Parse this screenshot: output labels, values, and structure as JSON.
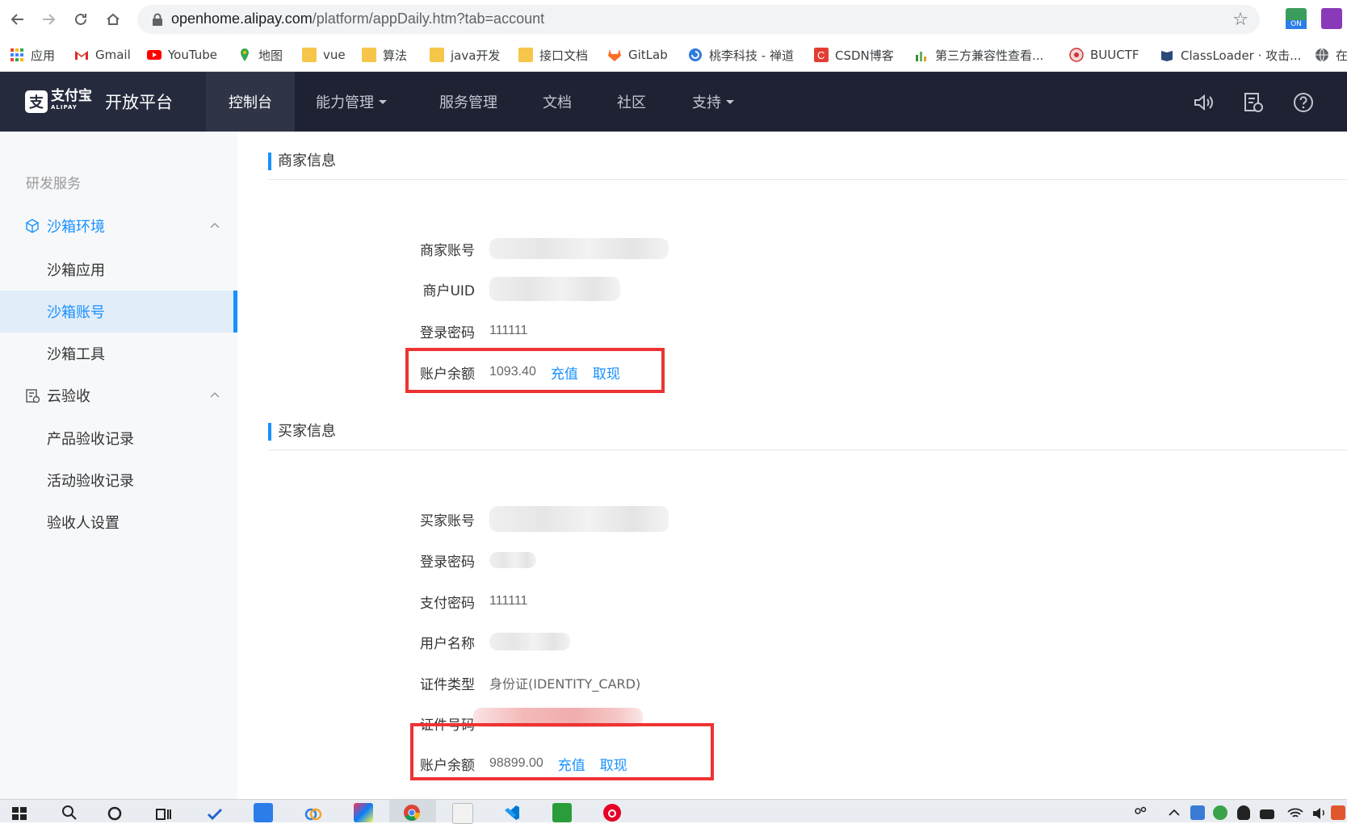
{
  "browser": {
    "url_host": "openhome.alipay.com",
    "url_path": "/platform/appDaily.htm?tab=account",
    "bookmarks": [
      {
        "label": "应用",
        "icon": "apps-grid-icon"
      },
      {
        "label": "Gmail",
        "icon": "gmail-icon"
      },
      {
        "label": "YouTube",
        "icon": "youtube-icon"
      },
      {
        "label": "地图",
        "icon": "maps-pin-icon"
      },
      {
        "label": "vue",
        "icon": "folder-icon"
      },
      {
        "label": "算法",
        "icon": "folder-icon"
      },
      {
        "label": "java开发",
        "icon": "folder-icon"
      },
      {
        "label": "接口文档",
        "icon": "folder-icon"
      },
      {
        "label": "GitLab",
        "icon": "gitlab-icon"
      },
      {
        "label": "桃李科技 - 禅道",
        "icon": "zentao-icon"
      },
      {
        "label": "CSDN博客",
        "icon": "csdn-icon"
      },
      {
        "label": "第三方兼容性查看...",
        "icon": "chart-icon"
      },
      {
        "label": "BUUCTF",
        "icon": "buuctf-icon"
      },
      {
        "label": "ClassLoader · 攻击...",
        "icon": "book-icon"
      },
      {
        "label": "在",
        "icon": "globe-icon"
      }
    ]
  },
  "header": {
    "logo_cn": "支付宝",
    "logo_en": "ALIPAY",
    "platform_title": "开放平台",
    "nav": [
      {
        "label": "控制台",
        "dropdown": false,
        "active": true
      },
      {
        "label": "能力管理",
        "dropdown": true,
        "active": false
      },
      {
        "label": "服务管理",
        "dropdown": false,
        "active": false
      },
      {
        "label": "文档",
        "dropdown": false,
        "active": false
      },
      {
        "label": "社区",
        "dropdown": false,
        "active": false
      },
      {
        "label": "支持",
        "dropdown": true,
        "active": false
      }
    ]
  },
  "sidebar": {
    "section_title": "研发服务",
    "groups": [
      {
        "label": "沙箱环境",
        "icon": "cube-icon",
        "items": [
          "沙箱应用",
          "沙箱账号",
          "沙箱工具"
        ],
        "active_item": "沙箱账号"
      },
      {
        "label": "云验收",
        "icon": "clipboard-icon",
        "items": [
          "产品验收记录",
          "活动验收记录",
          "验收人设置"
        ]
      }
    ]
  },
  "merchant": {
    "title": "商家信息",
    "account_label": "商家账号",
    "uid_label": "商户UID",
    "password_label": "登录密码",
    "password_value": "111111",
    "balance_label": "账户余额",
    "balance_value": "1093.40",
    "recharge": "充值",
    "withdraw": "取现"
  },
  "buyer": {
    "title": "买家信息",
    "account_label": "买家账号",
    "login_password_label": "登录密码",
    "pay_password_label": "支付密码",
    "pay_password_value": "111111",
    "username_label": "用户名称",
    "id_type_label": "证件类型",
    "id_type_value": "身份证(IDENTITY_CARD)",
    "id_number_label": "证件号码",
    "balance_label": "账户余额",
    "balance_value": "98899.00",
    "recharge": "充值",
    "withdraw": "取现"
  },
  "colors": {
    "accent": "#1890ff",
    "header_bg": "#1f2233",
    "highlight_box": "#ee3333"
  }
}
